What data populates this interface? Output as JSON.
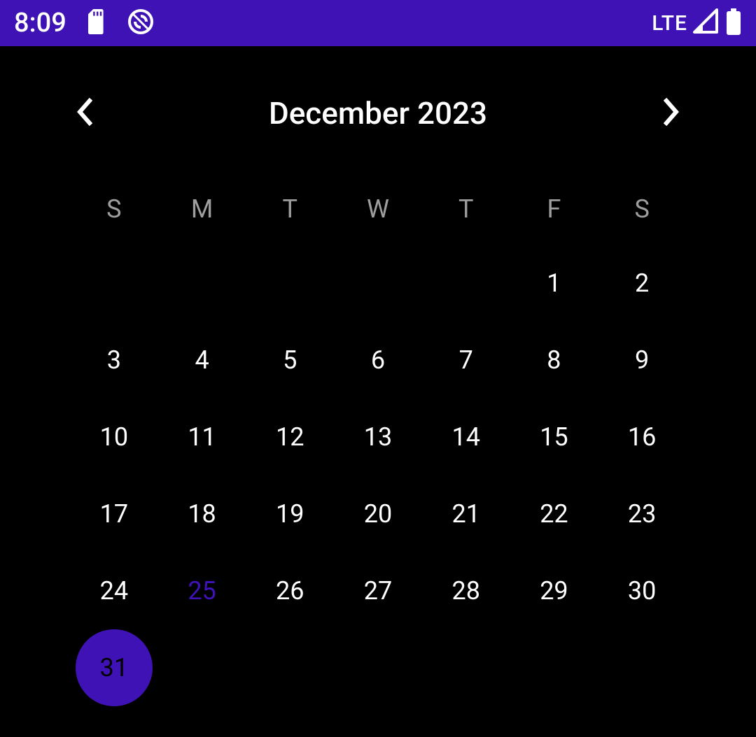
{
  "status_bar": {
    "time": "8:09",
    "network_label": "LTE"
  },
  "calendar": {
    "month_title": "December 2023",
    "weekdays": [
      "S",
      "M",
      "T",
      "W",
      "T",
      "F",
      "S"
    ],
    "leading_blanks": 5,
    "days": [
      {
        "n": "1"
      },
      {
        "n": "2"
      },
      {
        "n": "3"
      },
      {
        "n": "4"
      },
      {
        "n": "5"
      },
      {
        "n": "6"
      },
      {
        "n": "7"
      },
      {
        "n": "8"
      },
      {
        "n": "9"
      },
      {
        "n": "10"
      },
      {
        "n": "11"
      },
      {
        "n": "12"
      },
      {
        "n": "13"
      },
      {
        "n": "14"
      },
      {
        "n": "15"
      },
      {
        "n": "16"
      },
      {
        "n": "17"
      },
      {
        "n": "18"
      },
      {
        "n": "19"
      },
      {
        "n": "20"
      },
      {
        "n": "21"
      },
      {
        "n": "22"
      },
      {
        "n": "23"
      },
      {
        "n": "24"
      },
      {
        "n": "25",
        "highlighted": true
      },
      {
        "n": "26"
      },
      {
        "n": "27"
      },
      {
        "n": "28"
      },
      {
        "n": "29"
      },
      {
        "n": "30"
      },
      {
        "n": "31",
        "selected": true
      }
    ]
  }
}
